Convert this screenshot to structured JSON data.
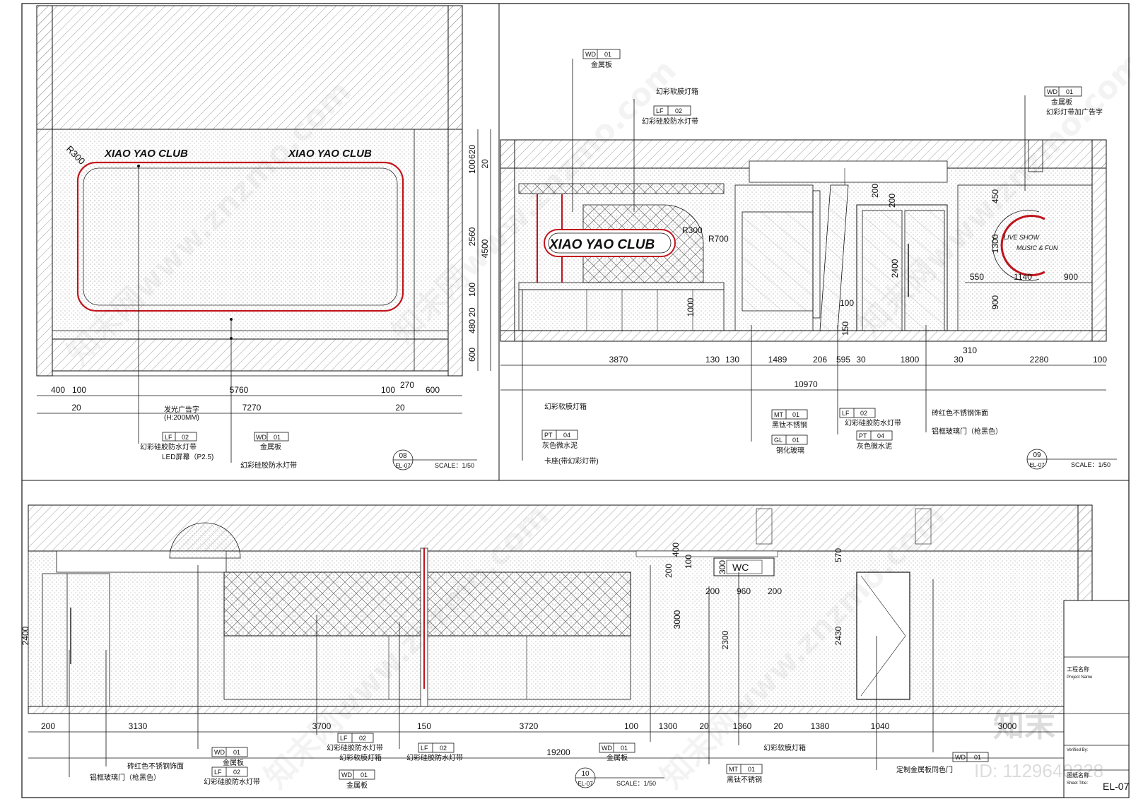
{
  "colors": {
    "line": "#111111",
    "accent": "#c0141c",
    "hatch": "#888888"
  },
  "panel08": {
    "brand_left": "XIAO YAO CLUB",
    "brand_right": "XIAO YAO CLUB",
    "radius": "R300",
    "vdims": [
      "620",
      "20",
      "100",
      "2560",
      "4500",
      "100",
      "20",
      "480",
      "600"
    ],
    "hdims_top": [
      "400",
      "100",
      "5760",
      "100",
      "270",
      "600"
    ],
    "hdims_bottom": [
      "20",
      "7270",
      "20"
    ],
    "note_sign": "发光广告字",
    "note_sign_h": "(H:200MM)",
    "tag_lf": {
      "code": "LF",
      "num": "02",
      "desc": "幻彩硅胶防水灯带"
    },
    "note_led": "LED屏幕（P2.5)",
    "tag_wd": {
      "code": "WD",
      "num": "01",
      "desc": "金属板"
    },
    "note_strip": "幻彩硅胶防水灯带",
    "title_num": "08",
    "title_sheet": "EL-07",
    "scale": "SCALE：1/50"
  },
  "panel09": {
    "tag_wd_top": {
      "code": "WD",
      "num": "01",
      "desc": "金属板"
    },
    "note_box": "幻彩软膜灯箱",
    "tag_lf_top": {
      "code": "LF",
      "num": "02",
      "desc": "幻彩硅胶防水灯带"
    },
    "tag_wd_right": {
      "code": "WD",
      "num": "01",
      "desc": "金属板"
    },
    "note_sign": "幻彩灯带加广告字",
    "brand": "XIAO YAO CLUB",
    "r300": "R300",
    "r700": "R700",
    "logo_line1": "LIVE SHOW",
    "logo_line2": "MUSIC & FUN",
    "vdims": [
      "200",
      "200",
      "2400",
      "1000",
      "450",
      "1300",
      "900",
      "100",
      "150"
    ],
    "hdims_inner": [
      "550",
      "1140",
      "900"
    ],
    "hdims": [
      "3870",
      "130",
      "130",
      "1489",
      "206",
      "595",
      "30",
      "1800",
      "30",
      "310",
      "2280",
      "100"
    ],
    "total": "10970",
    "note_box2": "幻彩软膜灯箱",
    "tag_mt": {
      "code": "MT",
      "num": "01",
      "desc": "黑钛不锈钢"
    },
    "tag_gl": {
      "code": "GL",
      "num": "01",
      "desc": "钢化玻璃"
    },
    "tag_lf_b": {
      "code": "LF",
      "num": "02",
      "desc": "幻彩硅胶防水灯带"
    },
    "tag_pt_b": {
      "code": "PT",
      "num": "04",
      "desc": "灰色微水泥"
    },
    "tag_pt_l": {
      "code": "PT",
      "num": "04",
      "desc": "灰色微水泥"
    },
    "note_red_steel": "砖红色不锈钢饰面",
    "note_door": "铝框玻璃门（枪黑色）",
    "note_seat": "卡座(带幻彩灯带)",
    "title_num": "09",
    "title_sheet": "EL-07",
    "scale": "SCALE：1/50"
  },
  "panel10": {
    "wc": "WC",
    "vdims": [
      "400",
      "200",
      "100",
      "300",
      "3000",
      "2300",
      "570",
      "2430",
      "2400"
    ],
    "mid_dims": [
      "200",
      "960",
      "200"
    ],
    "hdims": [
      "200",
      "3130",
      "3700",
      "150",
      "3720",
      "100",
      "1300",
      "20",
      "1360",
      "20",
      "1380",
      "1040",
      "3000"
    ],
    "total": "19200",
    "tag_wd_a": {
      "code": "WD",
      "num": "01",
      "desc": "金属板"
    },
    "tag_lf_a": {
      "code": "LF",
      "num": "02",
      "desc": "幻彩硅胶防水灯带"
    },
    "tag_lf_b": {
      "code": "LF",
      "num": "02",
      "desc": "幻彩硅胶防水灯带"
    },
    "note_box_b": "幻彩软膜灯箱",
    "tag_wd_b": {
      "code": "WD",
      "num": "01",
      "desc": "金属板"
    },
    "tag_lf_c": {
      "code": "LF",
      "num": "02",
      "desc": "幻彩硅胶防水灯带"
    },
    "tag_wd_c": {
      "code": "WD",
      "num": "01",
      "desc": "金属板"
    },
    "tag_mt": {
      "code": "MT",
      "num": "01",
      "desc": "黑钛不锈钢"
    },
    "note_box_c": "幻彩软膜灯箱",
    "note_custom": "定制金属板同色门",
    "tag_wd_d": {
      "code": "WD",
      "num": "01"
    },
    "note_red_steel": "砖红色不锈钢饰面",
    "note_door": "铝框玻璃门（枪黑色）",
    "title_num": "10",
    "title_sheet": "EL-07",
    "scale": "SCALE：1/50"
  },
  "titleblock": {
    "project_cn": "工程名称",
    "project_en": "Project Name",
    "verified_en": "Verified By:",
    "sheet_cn": "图纸名称",
    "sheet_en": "Sheet Title:",
    "sheet_no": "EL-07"
  },
  "watermark": {
    "logo": "知末",
    "id": "ID: 1129640228",
    "text": "知末网www.znzmo.com"
  }
}
